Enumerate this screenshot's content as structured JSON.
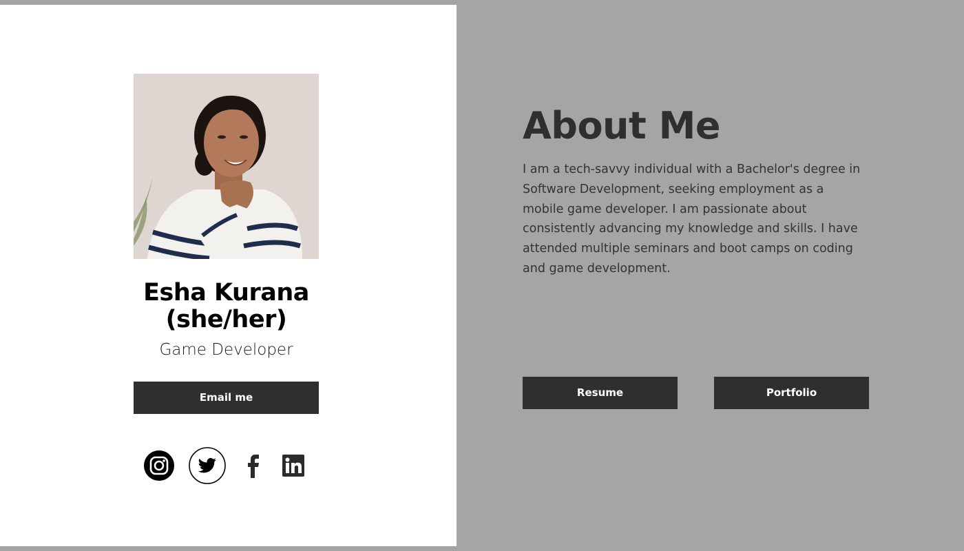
{
  "profile": {
    "name": "Esha Kurana (she/her)",
    "role": "Game Developer",
    "photo_alt": "Portrait photo"
  },
  "buttons": {
    "email": "Email me",
    "resume": "Resume",
    "portfolio": "Portfolio"
  },
  "about": {
    "title": "About Me",
    "text": "I am a tech-savvy individual with a Bachelor's degree in Software Development, seeking employment as a mobile game developer. I am passionate about consistently advancing my knowledge and skills. I have attended multiple seminars and boot camps on coding and game development."
  },
  "socials": [
    {
      "icon": "instagram-icon"
    },
    {
      "icon": "twitter-icon"
    },
    {
      "icon": "facebook-icon"
    },
    {
      "icon": "linkedin-icon"
    }
  ],
  "colors": {
    "background": "#a5a5a5",
    "card": "#ffffff",
    "button": "#2f2f2f",
    "button_text": "#ffffff",
    "title": "#2f2f2f",
    "body_text": "#333333"
  }
}
